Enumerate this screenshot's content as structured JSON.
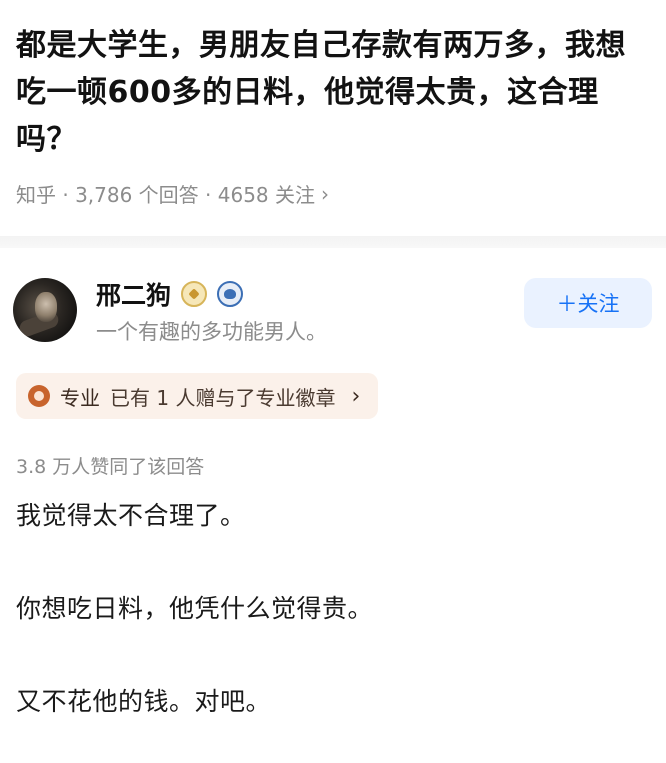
{
  "question": {
    "title": "都是大学生，男朋友自己存款有两万多，我想吃一顿600多的日料，他觉得太贵，这合理吗？",
    "meta": "知乎 · 3,786 个回答 · 4658 关注",
    "meta_chevron": "›"
  },
  "answer": {
    "author": {
      "name": "邢二狗",
      "bio": "一个有趣的多功能男人。",
      "badge_icons": [
        "certified-badge-icon",
        "avatar-badge-icon"
      ]
    },
    "follow_label": "＋关注",
    "pro_tag": {
      "icon": "medal-icon",
      "label": "专业",
      "text": "已有 1 人赠与了专业徽章",
      "chevron": "›"
    },
    "votes": "3.8 万人赞同了该回答",
    "paragraphs": [
      "我觉得太不合理了。",
      "你想吃日料，他凭什么觉得贵。",
      "又不花他的钱。对吧。"
    ]
  },
  "colors": {
    "accent": "#1772f6",
    "follow_bg": "#eaf2ff",
    "pro_bg": "#fbf1ea",
    "meta_text": "#8c8c8c"
  }
}
